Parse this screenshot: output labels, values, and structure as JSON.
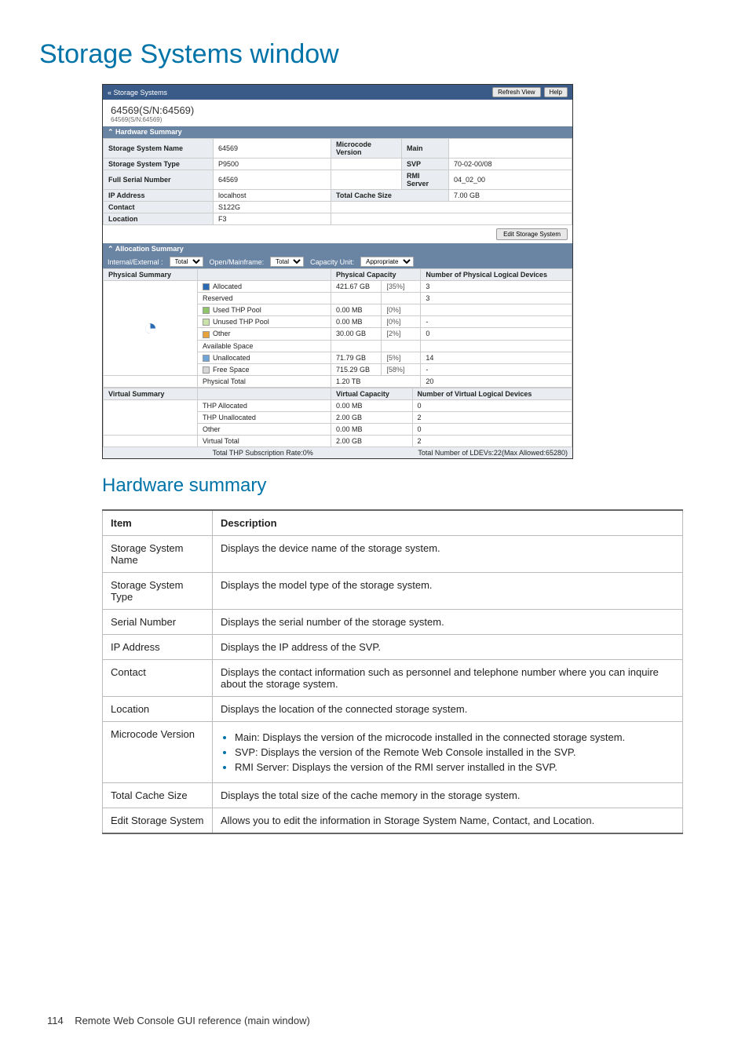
{
  "page": {
    "title": "Storage Systems window",
    "section_title": "Hardware summary",
    "footer_page": "114",
    "footer_text": "Remote Web Console GUI reference (main window)"
  },
  "shot": {
    "breadcrumb": "« Storage Systems",
    "btn_refresh": "Refresh View",
    "btn_help": "Help",
    "device_main": "64569(S/N:64569)",
    "device_sub": "64569(S/N:64569)",
    "hw_head": "Hardware Summary",
    "hw": {
      "r1l": "Storage System Name",
      "r1v": "64569",
      "r2l": "Storage System Type",
      "r2v": "P9500",
      "r3l": "Full Serial Number",
      "r3v": "64569",
      "r4l": "IP Address",
      "r4v": "localhost",
      "r5l": "Contact",
      "r5v": "S122G",
      "r6l": "Location",
      "r6v": "F3",
      "mvl": "Microcode Version",
      "mv_main_l": "Main",
      "mv_main_v": "",
      "mv_svp_l": "SVP",
      "mv_svp_v": "70-02-00/08",
      "mv_rmi_l": "RMI Server",
      "mv_rmi_v": "04_02_00",
      "tcl": "Total Cache Size",
      "tcv": "7.00 GB",
      "edit_btn": "Edit Storage System"
    },
    "alloc_head": "Allocation Summary",
    "filters": {
      "ie_label": "Internal/External :",
      "ie_value": "Total",
      "om_label": "Open/Mainframe:",
      "om_value": "Total",
      "cu_label": "Capacity Unit:",
      "cu_value": "Appropriate"
    },
    "phys": {
      "head_summary": "Physical Summary",
      "head_cap": "Physical Capacity",
      "head_dev": "Number of Physical Logical Devices",
      "rows": [
        {
          "color": "#2a6bb3",
          "name": "Allocated",
          "cap": "421.67 GB",
          "pct": "[35%]",
          "dev": "3"
        },
        {
          "color": "#",
          "name": "Reserved",
          "cap": "",
          "pct": "",
          "dev": "3"
        },
        {
          "color": "#8fc46a",
          "name": "Used THP Pool",
          "cap": "0.00 MB",
          "pct": "[0%]",
          "dev": ""
        },
        {
          "color": "#c9e2a7",
          "name": "Unused THP Pool",
          "cap": "0.00 MB",
          "pct": "[0%]",
          "dev": "-"
        },
        {
          "color": "#e8a23a",
          "name": "Other",
          "cap": "30.00 GB",
          "pct": "[2%]",
          "dev": "0"
        },
        {
          "color": "#",
          "name": "Available Space",
          "cap": "",
          "pct": "",
          "dev": ""
        },
        {
          "color": "#6fa4d6",
          "name": "Unallocated",
          "cap": "71.79 GB",
          "pct": "[5%]",
          "dev": "14"
        },
        {
          "color": "#d6d6d6",
          "name": "Free Space",
          "cap": "715.29 GB",
          "pct": "[58%]",
          "dev": "-"
        }
      ],
      "total_label": "Physical Total",
      "total_cap": "1.20 TB",
      "total_dev": "20"
    },
    "virt": {
      "head_summary": "Virtual Summary",
      "head_cap": "Virtual Capacity",
      "head_dev": "Number of Virtual Logical Devices",
      "rows": [
        {
          "name": "THP Allocated",
          "cap": "0.00 MB",
          "dev": "0"
        },
        {
          "name": "THP Unallocated",
          "cap": "2.00 GB",
          "dev": "2"
        },
        {
          "name": "Other",
          "cap": "0.00 MB",
          "dev": "0"
        }
      ],
      "total_label": "Virtual Total",
      "total_cap": "2.00 GB",
      "total_dev": "2",
      "foot_left": "Total THP Subscription Rate:0%",
      "foot_right": "Total Number of LDEVs:22(Max Allowed:65280)"
    }
  },
  "desc": {
    "hdr_item": "Item",
    "hdr_desc": "Description",
    "rows": [
      {
        "item": "Storage System Name",
        "desc": "Displays the device name of the storage system."
      },
      {
        "item": "Storage System Type",
        "desc": "Displays the model type of the storage system."
      },
      {
        "item": "Serial Number",
        "desc": "Displays the serial number of the storage system."
      },
      {
        "item": "IP Address",
        "desc": "Displays the IP address of the SVP."
      },
      {
        "item": "Contact",
        "desc": "Displays the contact information such as personnel and telephone number where you can inquire about the storage system."
      },
      {
        "item": "Location",
        "desc": "Displays the location of the connected storage system."
      },
      {
        "item": "Microcode Version",
        "desc_list": [
          "Main: Displays the version of the microcode installed in the connected storage system.",
          "SVP: Displays the version of the Remote Web Console installed in the SVP.",
          "RMI Server: Displays the version of the RMI server installed in the SVP."
        ]
      },
      {
        "item": "Total Cache Size",
        "desc": "Displays the total size of the cache memory in the storage system."
      },
      {
        "item": "Edit Storage System",
        "desc": "Allows you to edit the information in Storage System Name, Contact, and Location."
      }
    ]
  }
}
